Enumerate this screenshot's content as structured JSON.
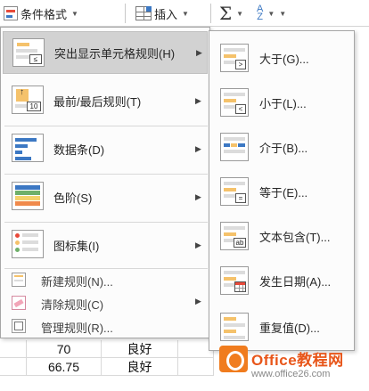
{
  "ribbon": {
    "conditional_format": "条件格式",
    "insert": "插入",
    "autosum_icon": "sigma-icon",
    "sort_icon": "sort-filter-icon"
  },
  "menu": {
    "items": [
      {
        "label": "突出显示单元格规则(H)",
        "icon": "highlight-cells-icon",
        "has_submenu": true,
        "selected": true
      },
      {
        "label": "最前/最后规则(T)",
        "icon": "top-bottom-icon",
        "badge": "10",
        "has_submenu": true
      },
      {
        "label": "数据条(D)",
        "icon": "data-bars-icon",
        "has_submenu": true
      },
      {
        "label": "色阶(S)",
        "icon": "color-scales-icon",
        "has_submenu": true
      },
      {
        "label": "图标集(I)",
        "icon": "icon-sets-icon",
        "has_submenu": true
      }
    ],
    "commands": [
      {
        "label": "新建规则(N)...",
        "icon": "new-rule-icon"
      },
      {
        "label": "清除规则(C)",
        "icon": "clear-rules-icon",
        "has_submenu": true
      },
      {
        "label": "管理规则(R)...",
        "icon": "manage-rules-icon"
      }
    ],
    "submenu_arrow": "▶"
  },
  "submenu": {
    "items": [
      {
        "label": "大于(G)...",
        "icon": "greater-than-icon",
        "badge": ">"
      },
      {
        "label": "小于(L)...",
        "icon": "less-than-icon",
        "badge": "<"
      },
      {
        "label": "介于(B)...",
        "icon": "between-icon"
      },
      {
        "label": "等于(E)...",
        "icon": "equal-to-icon",
        "badge": "="
      },
      {
        "label": "文本包含(T)...",
        "icon": "text-contains-icon",
        "badge": "ab"
      },
      {
        "label": "发生日期(A)...",
        "icon": "date-occurring-icon"
      },
      {
        "label": "重复值(D)...",
        "icon": "duplicate-values-icon"
      }
    ]
  },
  "sheet": {
    "rows": [
      {
        "value": "70",
        "grade": "良好"
      },
      {
        "value": "66.75",
        "grade": "良好"
      }
    ]
  },
  "watermark": {
    "title": "Office教程网",
    "url": "www.office26.com"
  },
  "colors": {
    "highlight": "#d2d2d2",
    "accent_orange": "#f5c26b",
    "accent_blue": "#3c78c3",
    "watermark_orange": "#e8561a"
  }
}
